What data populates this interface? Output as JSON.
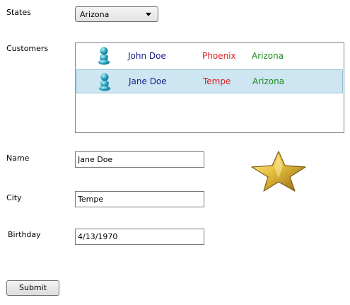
{
  "states": {
    "label": "States",
    "selected": "Arizona"
  },
  "customers": {
    "label": "Customers",
    "rows": [
      {
        "name": "John Doe",
        "city": "Phoenix",
        "state": "Arizona",
        "selected": false
      },
      {
        "name": "Jane Doe",
        "city": "Tempe",
        "state": "Arizona",
        "selected": true
      }
    ]
  },
  "form": {
    "name_label": "Name",
    "name_value": "Jane Doe",
    "city_label": "City",
    "city_value": "Tempe",
    "birthday_label": "Birthday",
    "birthday_value": "4/13/1970"
  },
  "submit_label": "Submit",
  "colors": {
    "name": "#1b1b8a",
    "city": "#e02020",
    "state": "#1f8a1f",
    "selection": "#cde6f1",
    "star": "#d9b43a"
  },
  "icons": {
    "customer": "person-icon",
    "decoration": "star-icon"
  }
}
